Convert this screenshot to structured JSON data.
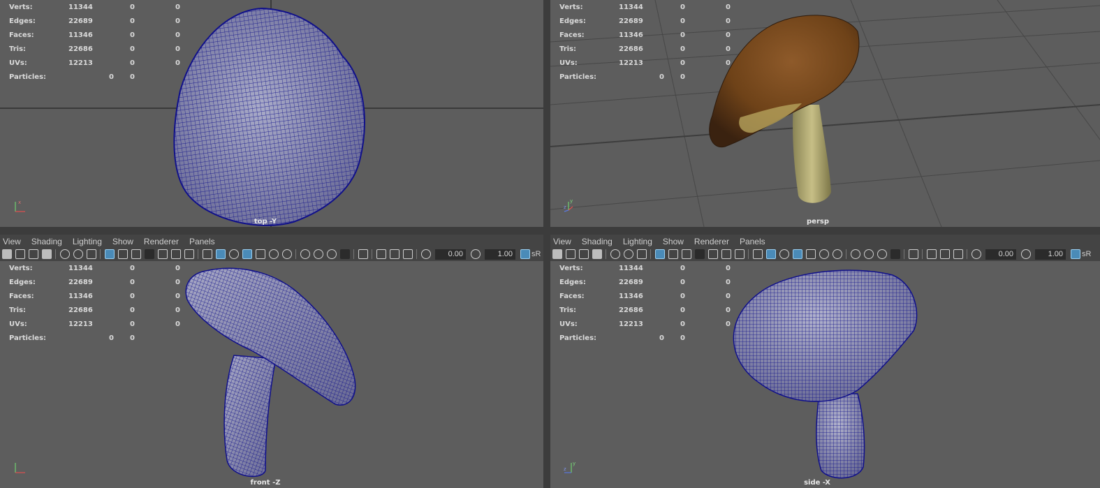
{
  "stats": {
    "rows": [
      {
        "label": "Verts:",
        "v1": "11344",
        "v2": "0",
        "v3": "0"
      },
      {
        "label": "Edges:",
        "v1": "22689",
        "v2": "0",
        "v3": "0"
      },
      {
        "label": "Faces:",
        "v1": "11346",
        "v2": "0",
        "v3": "0"
      },
      {
        "label": "Tris:",
        "v1": "22686",
        "v2": "0",
        "v3": "0"
      },
      {
        "label": "UVs:",
        "v1": "12213",
        "v2": "0",
        "v3": "0"
      }
    ],
    "particles": {
      "label": "Particles:",
      "v1": "0",
      "v2": "0"
    }
  },
  "cameras": {
    "top": "top -Y",
    "persp": "persp",
    "front": "front -Z",
    "side": "side -X"
  },
  "menu": [
    "View",
    "Shading",
    "Lighting",
    "Show",
    "Renderer",
    "Panels"
  ],
  "toolbar": {
    "exposure": "0.00",
    "gamma": "1.00",
    "color_space": "sR"
  },
  "axis_labels": {
    "y": "y",
    "x": "x",
    "z": "z"
  },
  "colors": {
    "viewport_bg": "#5d5d5d",
    "wire": "#10108a",
    "mushroom_cap": "#7a4a22",
    "mushroom_stem": "#b9b078",
    "grid": "#3f3f3f",
    "toolbar_active": "#4a8bb8"
  },
  "icons": [
    "camera-icon",
    "select-icon",
    "grid-icon",
    "film-gate-icon",
    "wireframe-icon",
    "smooth-shade-icon",
    "xray-icon",
    "light-icon",
    "isolate-icon",
    "exposure-icon",
    "gamma-icon",
    "color-management-icon"
  ]
}
